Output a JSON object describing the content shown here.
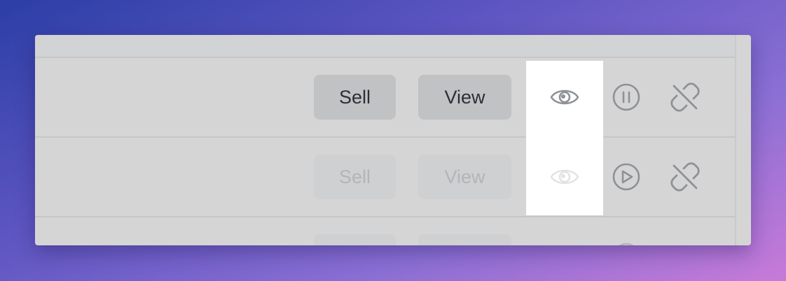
{
  "rows": [
    {
      "sell_label": "Sell",
      "view_label": "View",
      "enabled": true,
      "state_icon": "pause-circle-icon",
      "unlink_icon": "unlink-icon"
    },
    {
      "sell_label": "Sell",
      "view_label": "View",
      "enabled": false,
      "state_icon": "play-circle-icon",
      "unlink_icon": "unlink-icon"
    },
    {
      "sell_label": "",
      "view_label": "",
      "enabled": false,
      "state_icon": "pause-circle-icon",
      "unlink_icon": "unlink-icon"
    }
  ],
  "colors": {
    "panel_bg": "#d5d5d5",
    "button_bg": "#c1c2c4",
    "button_text": "#2b2f36",
    "icon_gray": "#8e9197",
    "highlight": "#ffffff"
  }
}
